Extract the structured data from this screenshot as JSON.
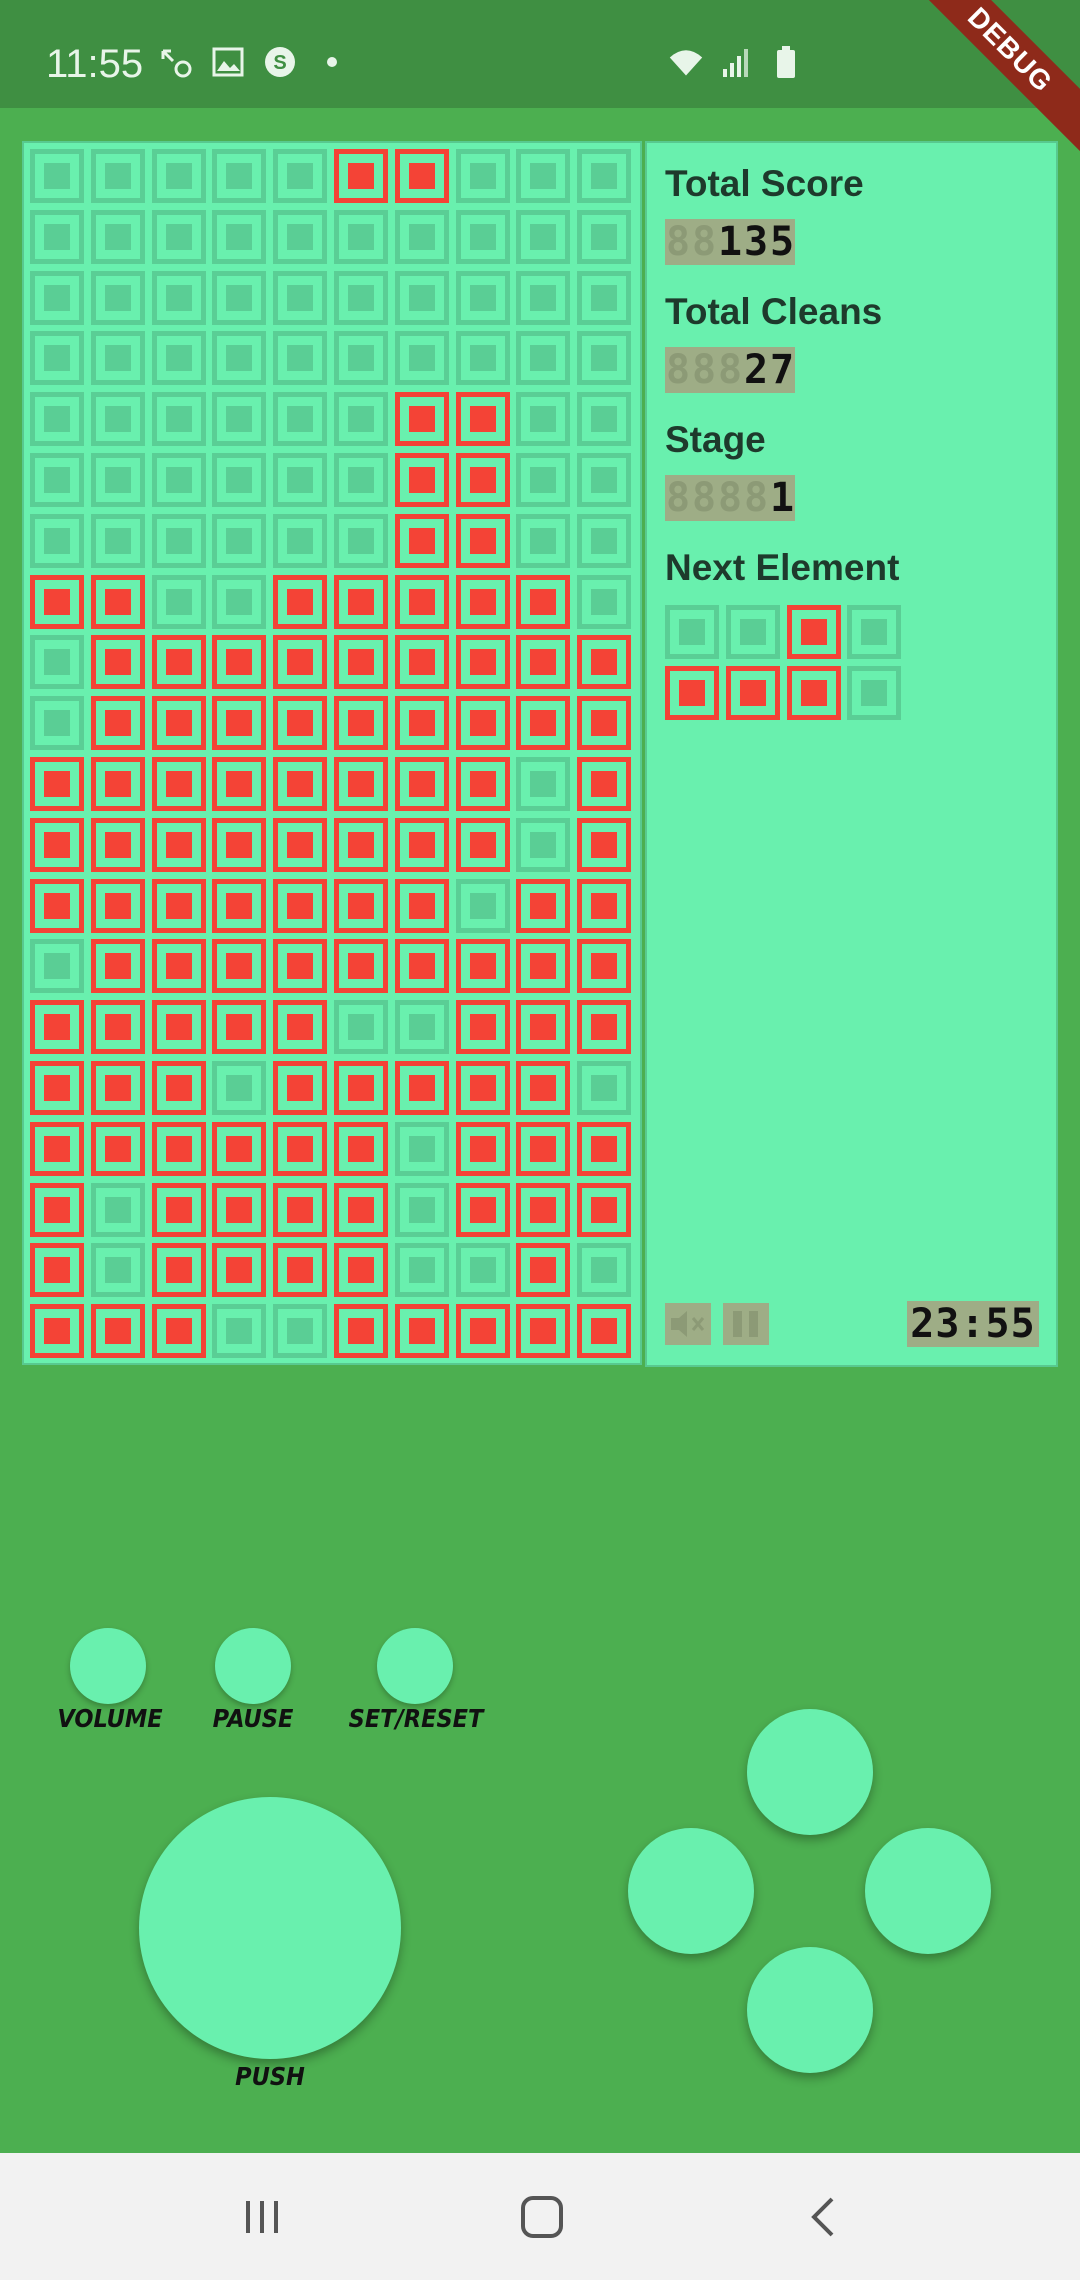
{
  "status_bar": {
    "time": "11:55",
    "left_icons": [
      "missed-call-icon",
      "image-icon",
      "s-app-icon",
      "dot-icon"
    ],
    "right_icons": [
      "wifi-icon",
      "signal-icon",
      "battery-icon"
    ],
    "debug_label": "DEBUG"
  },
  "board": {
    "columns": 10,
    "rows": 20,
    "grid": [
      "0000011000",
      "0000000000",
      "0000000000",
      "0000000000",
      "0000001100",
      "0000001100",
      "0000001100",
      "1100111110",
      "0111111111",
      "0111111111",
      "1111111101",
      "1111111101",
      "1111111011",
      "0111111111",
      "1111100111",
      "1110111110",
      "1111110111",
      "1011110111",
      "1011110010",
      "1110011111"
    ],
    "colors": {
      "filled": "#F44336",
      "empty": "#5ACE95",
      "background": "#69F0AE"
    }
  },
  "panel": {
    "score_label": "Total Score",
    "score_value": "135",
    "cleans_label": "Total Cleans",
    "cleans_value": "27",
    "stage_label": "Stage",
    "stage_value": "1",
    "next_label": "Next Element",
    "next_grid": [
      "0010",
      "1110"
    ],
    "clock": "23:55",
    "mute_icon": "volume-mute-icon",
    "pause_icon": "pause-icon"
  },
  "controls": {
    "volume_label": "VOLUME",
    "pause_label": "PAUSE",
    "reset_label": "SET/RESET",
    "push_label": "PUSH",
    "dpad": [
      "up",
      "left",
      "right",
      "down"
    ]
  },
  "nav": {
    "icons": [
      "recents-icon",
      "home-icon",
      "back-icon"
    ]
  }
}
